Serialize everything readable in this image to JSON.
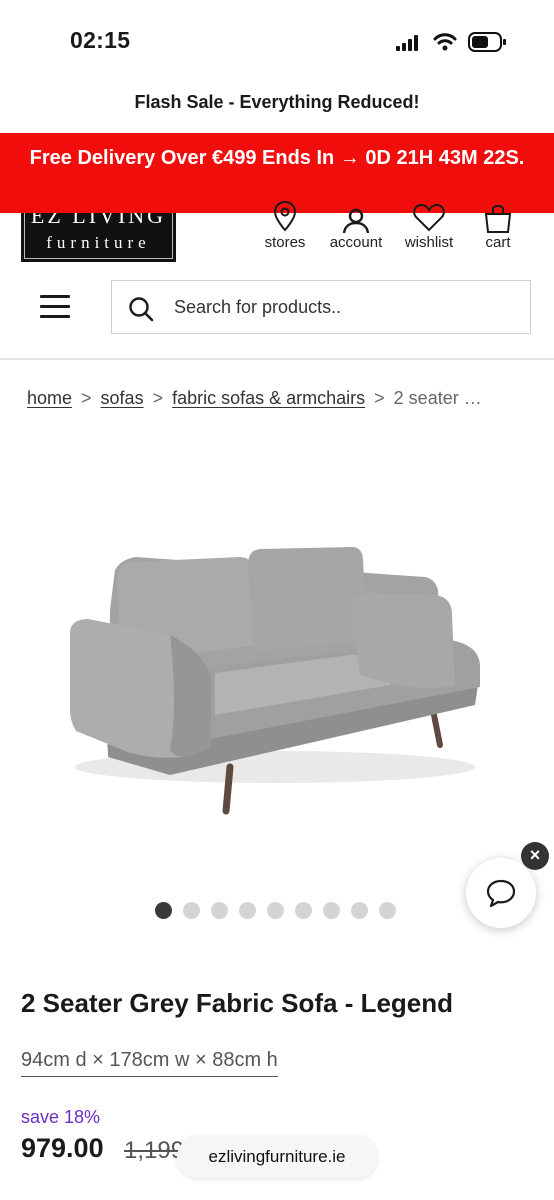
{
  "status_bar": {
    "time": "02:15"
  },
  "banner": {
    "flash_sale": "Flash Sale - Everything Reduced!",
    "promo": "Free Delivery Over €499 Ends In → 0D 21H 43M 22S."
  },
  "header": {
    "logo_top": "EZ LIVING",
    "logo_bottom": "furniture",
    "nav": [
      {
        "label": "stores",
        "icon": "location-pin-icon"
      },
      {
        "label": "account",
        "icon": "account-icon"
      },
      {
        "label": "wishlist",
        "icon": "heart-icon"
      },
      {
        "label": "cart",
        "icon": "cart-icon"
      }
    ],
    "search_placeholder": "Search for products.."
  },
  "breadcrumbs": {
    "items": [
      "home",
      "sofas",
      "fabric sofas & armchairs"
    ],
    "current": "2 seater …",
    "separator": ">"
  },
  "gallery": {
    "total_images": 9,
    "active_index": 0
  },
  "product": {
    "title": "2 Seater Grey Fabric Sofa - Legend",
    "dimensions": "94cm d × 178cm w × 88cm h",
    "save": "save 18%",
    "price": "979.00",
    "old_price": "1,199"
  },
  "browser": {
    "url": "ezlivingfurniture.ie"
  },
  "colors": {
    "promo_bg": "#f20d0d",
    "save_text": "#6b2fc7"
  }
}
